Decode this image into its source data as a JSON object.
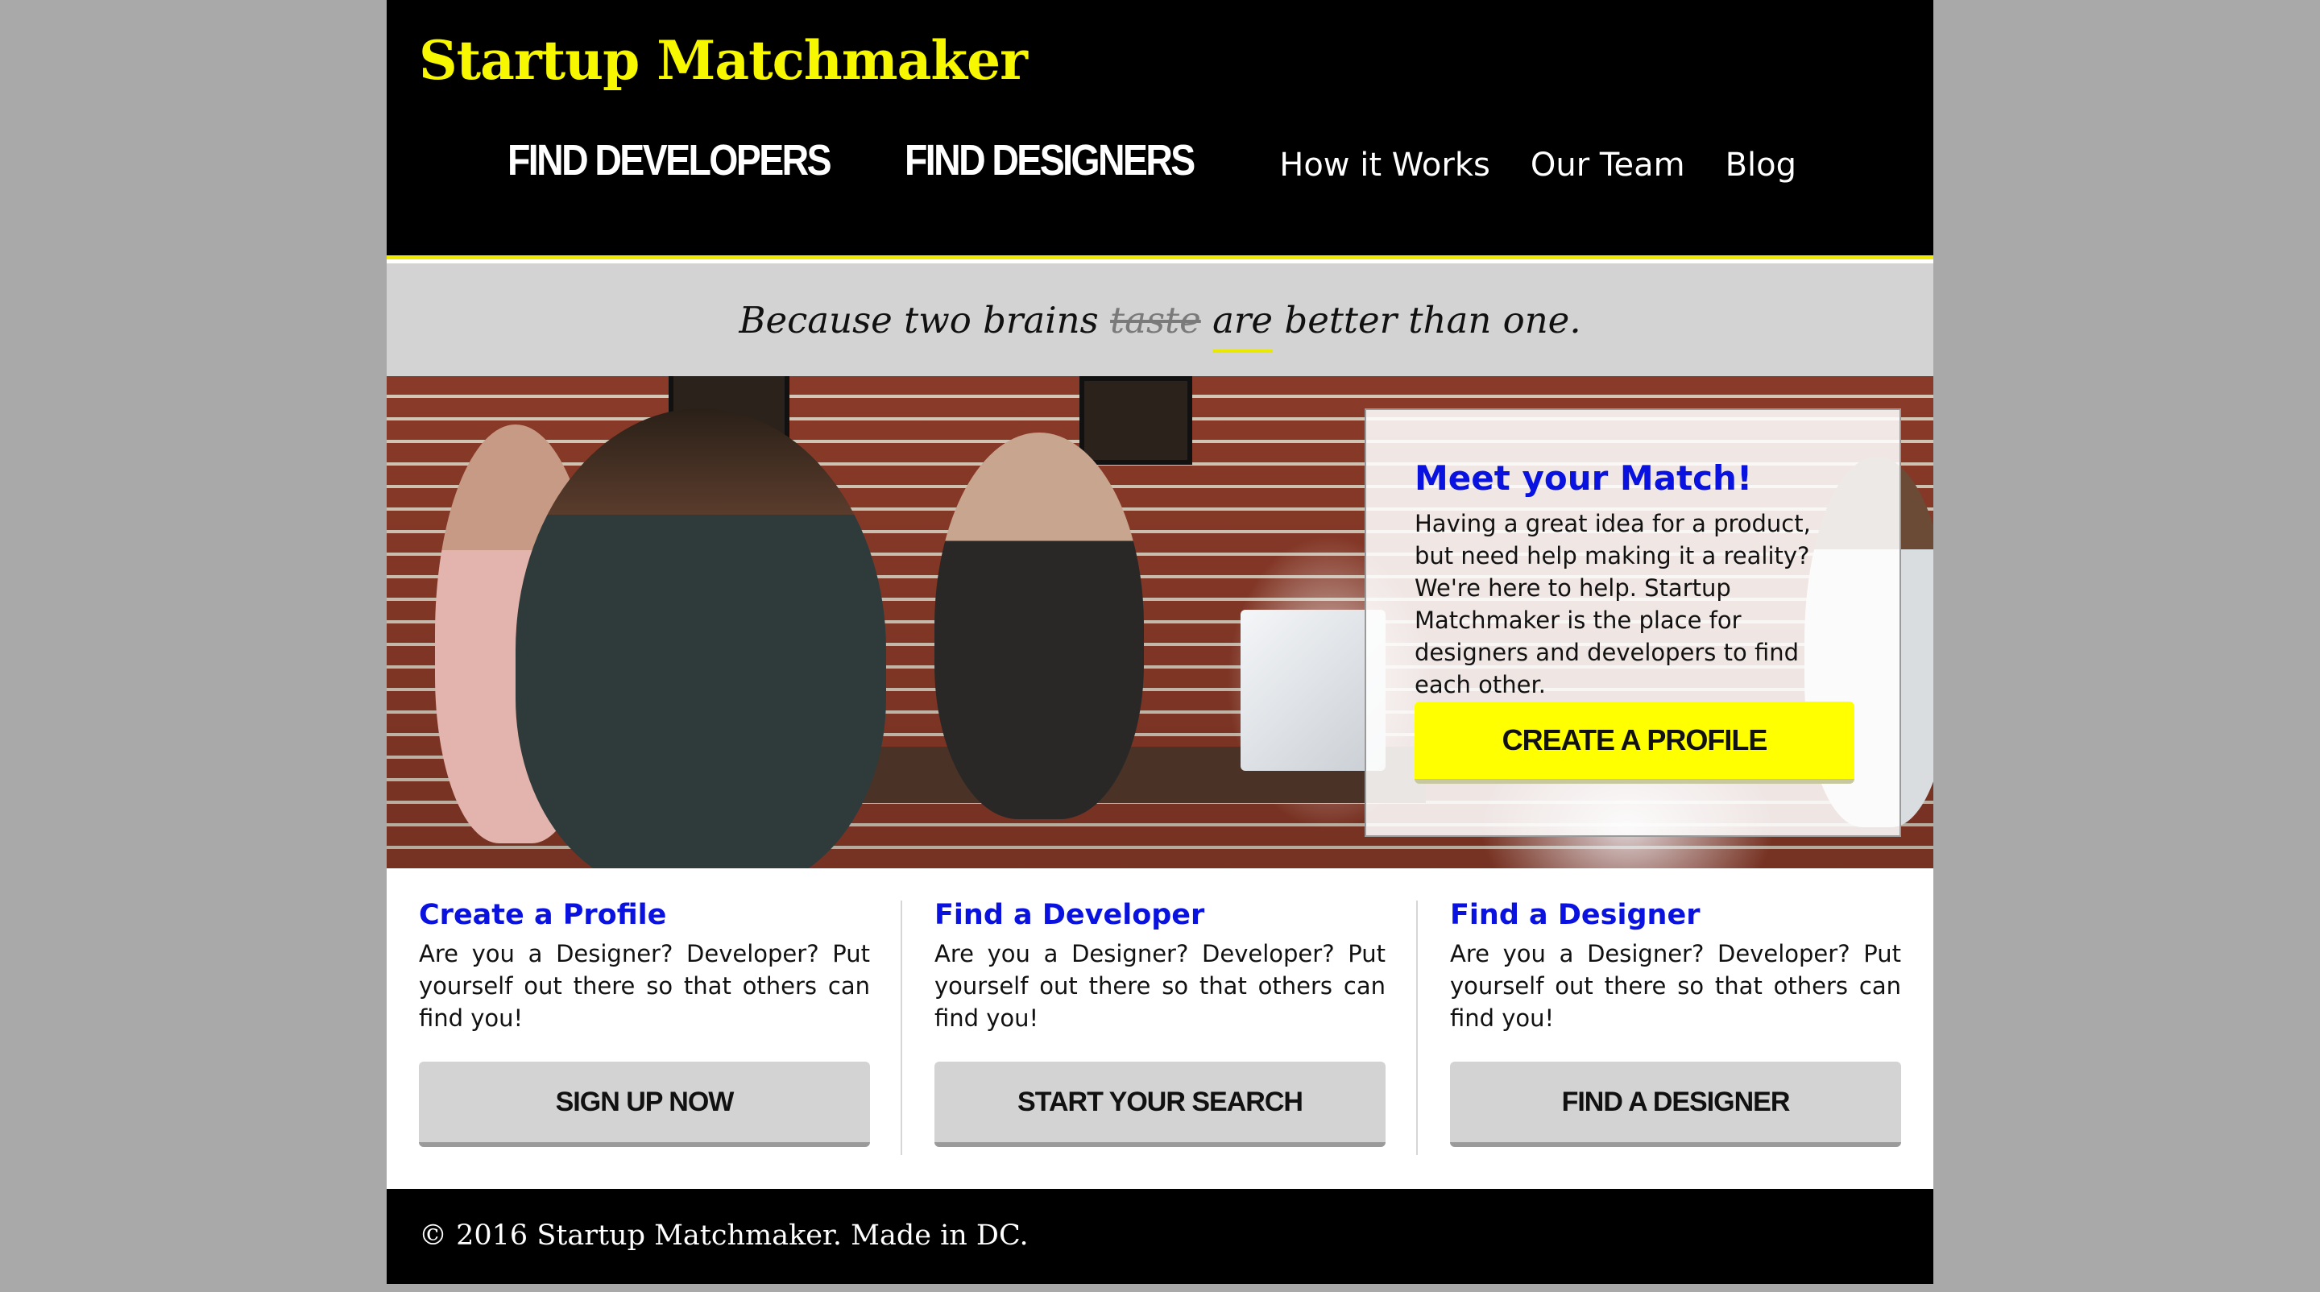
{
  "header": {
    "brand": "Startup Matchmaker",
    "nav": {
      "find_developers": "FIND DEVELOPERS",
      "find_designers": "FIND DESIGNERS",
      "how_it_works": "How it Works",
      "our_team": "Our Team",
      "blog": "Blog"
    }
  },
  "tagline": {
    "part1": "Because two brains ",
    "struck": "taste",
    "space": " ",
    "underlined": "are",
    "part2": " better than one."
  },
  "hero": {
    "card": {
      "title": "Meet your Match!",
      "body": "Having a great idea for a product, but need help making it a reality? We're here to help. Startup Matchmaker is the place for designers and developers to find each other.",
      "button_label": "CREATE A PROFILE"
    }
  },
  "features": [
    {
      "title": "Create a Profile",
      "text": "Are you a Designer? Developer? Put yourself out there so that others can find you!",
      "button_label": "SIGN UP NOW"
    },
    {
      "title": "Find a Developer",
      "text": "Are you a Designer? Developer? Put yourself out there so that others can find you!",
      "button_label": "START YOUR SEARCH"
    },
    {
      "title": "Find a Designer",
      "text": "Are you a Designer? Developer? Put yourself out there so that others can find you!",
      "button_label": "FIND A DESIGNER"
    }
  ],
  "footer": {
    "text": "© 2016 Startup Matchmaker. Made in DC."
  },
  "colors": {
    "brand_yellow": "#f7f700",
    "link_blue": "#0a12e0",
    "header_bg": "#000000",
    "tagline_bg": "#d3d3d3",
    "button_grey": "#d3d3d3",
    "button_yellow": "#ffff00",
    "page_backdrop": "#a9a9a9"
  }
}
